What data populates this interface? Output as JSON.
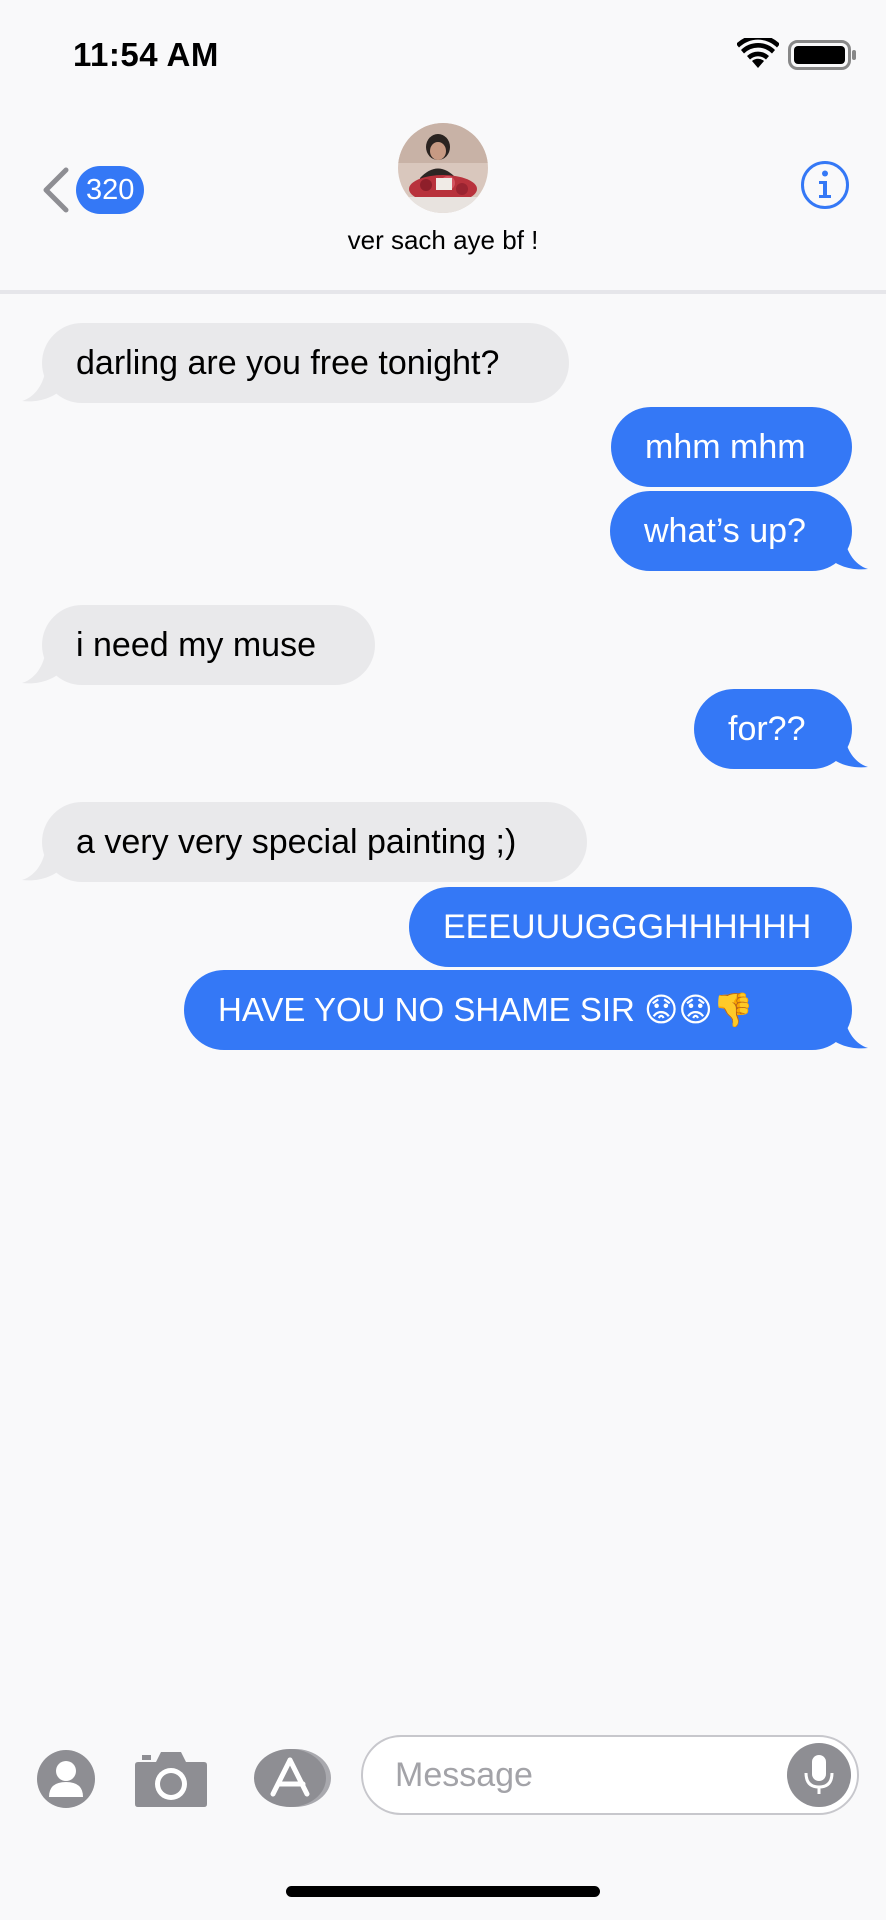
{
  "status_bar": {
    "time": "11:54 AM"
  },
  "header": {
    "unread_count": "320",
    "contact_name": "ver sach aye bf !"
  },
  "messages": [
    {
      "direction": "received",
      "text": "darling are you free tonight?"
    },
    {
      "direction": "sent",
      "text": "mhm mhm"
    },
    {
      "direction": "sent",
      "text": "what’s up?"
    },
    {
      "direction": "received",
      "text": "i need my muse"
    },
    {
      "direction": "sent",
      "text": "for??"
    },
    {
      "direction": "received",
      "text": "a very very special painting ;)"
    },
    {
      "direction": "sent",
      "text": "EEEUUUGGGHHHHHH"
    },
    {
      "direction": "sent",
      "text": "HAVE YOU NO SHAME SIR 😟😟👎"
    }
  ],
  "input_bar": {
    "placeholder": "Message"
  },
  "colors": {
    "accent": "#3478f6",
    "received_bubble": "#e9e9eb",
    "background": "#f9f9fa"
  },
  "icons": [
    "back-chevron-icon",
    "info-icon",
    "contact-icon",
    "camera-icon",
    "app-store-icon",
    "microphone-icon",
    "wifi-icon",
    "battery-icon"
  ]
}
